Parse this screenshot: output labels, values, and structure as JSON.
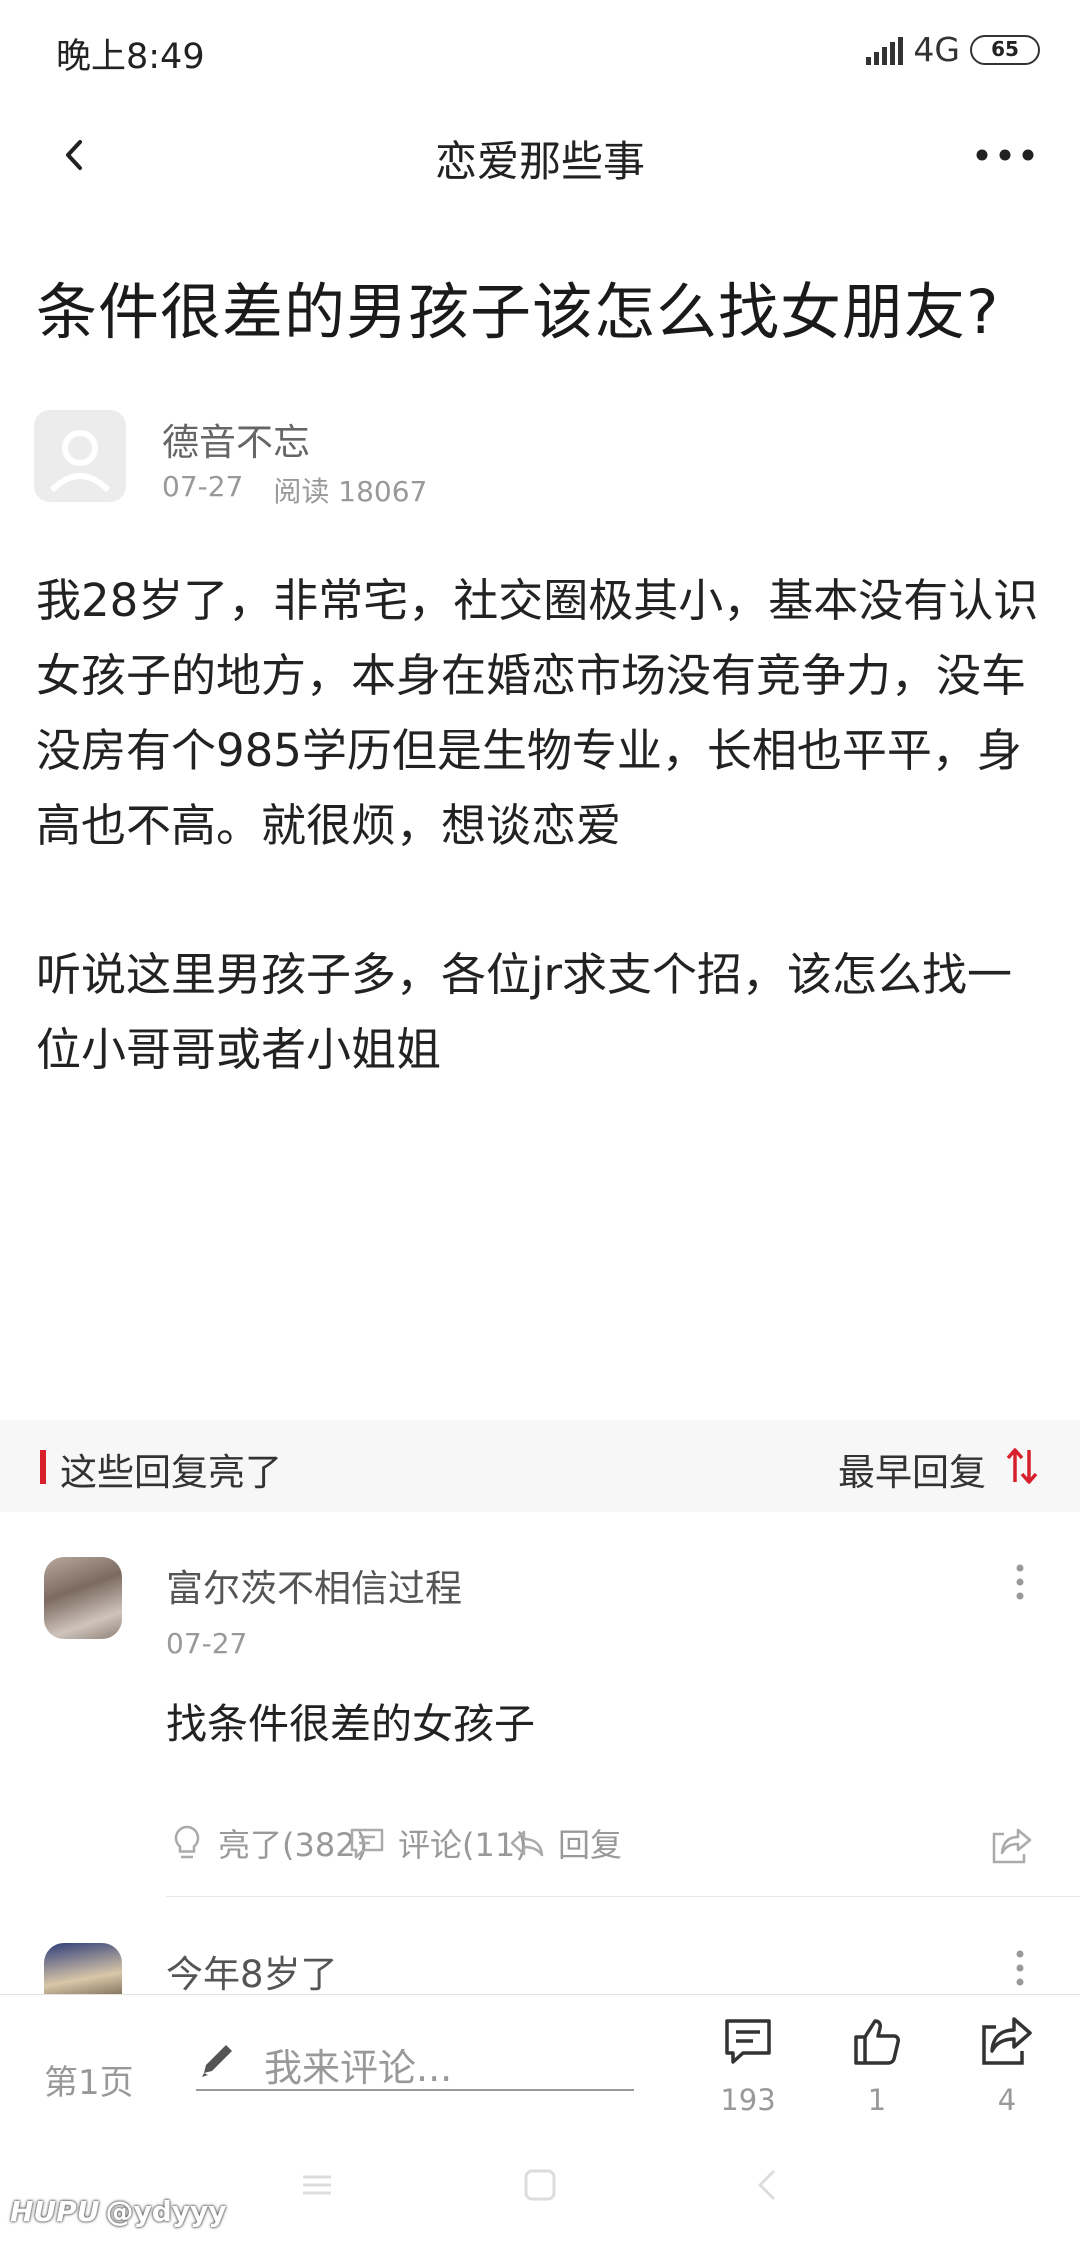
{
  "status": {
    "time": "晚上8:49",
    "network": "4G",
    "battery": "65"
  },
  "header": {
    "title": "恋爱那些事"
  },
  "post": {
    "title": "条件很差的男孩子该怎么找女朋友?",
    "author": "德音不忘",
    "date": "07-27",
    "reads": "阅读 18067",
    "paragraphs": [
      "我28岁了，非常宅，社交圈极其小，基本没有认识女孩子的地方，本身在婚恋市场没有竞争力，没车没房有个985学历但是生物专业，长相也平平，身高也不高。就很烦，想谈恋爱",
      "听说这里男孩子多，各位jr求支个招，该怎么找一位小哥哥或者小姐姐"
    ]
  },
  "replies_section": {
    "title": "这些回复亮了",
    "sort_label": "最早回复",
    "accent_color": "#d7202c"
  },
  "replies": [
    {
      "name": "富尔茨不相信过程",
      "date": "07-27",
      "text": "找条件很差的女孩子",
      "light": "亮了(382)",
      "comments": "评论(11)",
      "reply": "回复"
    },
    {
      "name": "今年8岁了"
    }
  ],
  "bottom_bar": {
    "page": "第1页",
    "comment_placeholder": "我来评论...",
    "comments_count": "193",
    "likes_count": "1",
    "shares_count": "4"
  },
  "watermark": {
    "brand": "HUPU",
    "user": "@ydyyy"
  }
}
